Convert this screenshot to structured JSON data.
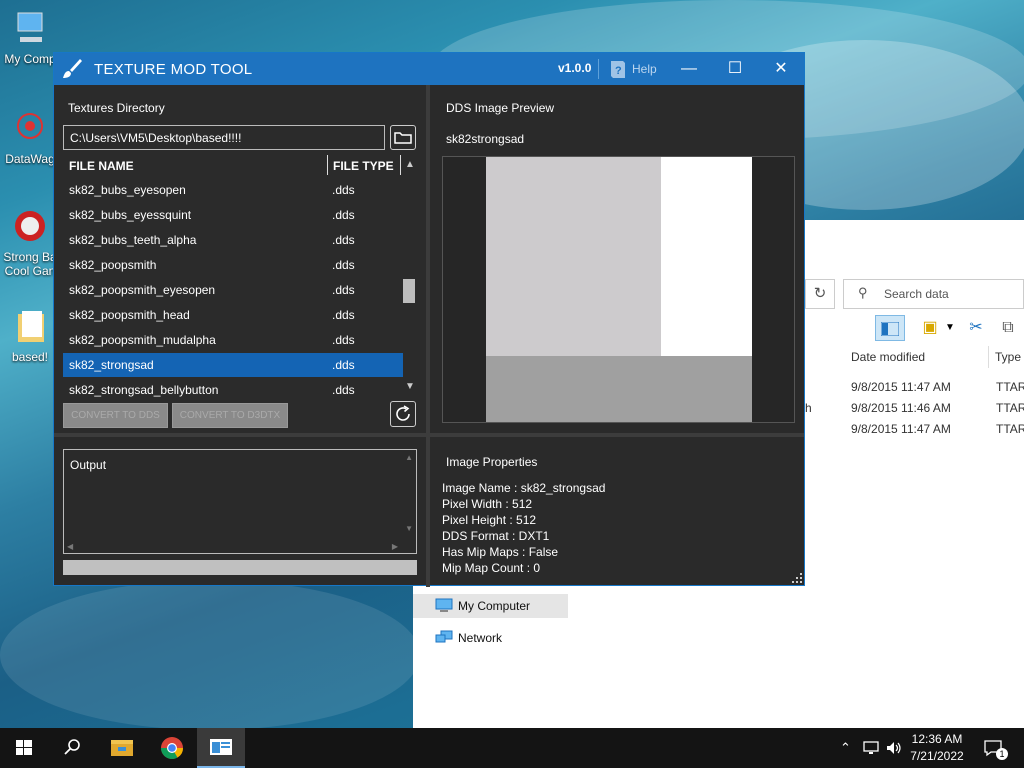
{
  "desktop": {
    "icons": [
      {
        "label": "My Comp"
      },
      {
        "label": "DataWag"
      },
      {
        "label": "Strong Ba Cool Gan"
      },
      {
        "label": "based!"
      }
    ]
  },
  "explorer": {
    "search_placeholder": "Search data",
    "columns": [
      "Date modified",
      "Type"
    ],
    "rows": [
      {
        "extra": "",
        "date": "9/8/2015 11:47 AM",
        "type": "TTARC"
      },
      {
        "extra": "h",
        "date": "9/8/2015 11:46 AM",
        "type": "TTARC"
      },
      {
        "extra": "",
        "date": "9/8/2015 11:47 AM",
        "type": "TTARC"
      }
    ],
    "nav": [
      {
        "label": "My Computer"
      },
      {
        "label": "Network"
      }
    ]
  },
  "app": {
    "title": "TEXTURE MOD TOOL",
    "version": "v1.0.0",
    "help_label": "Help",
    "textures_dir_label": "Textures Directory",
    "dir_path": "C:\\Users\\VM5\\Desktop\\based!!!!",
    "col_file_name": "FILE NAME",
    "col_file_type": "FILE TYPE",
    "files": [
      {
        "name": "sk82_bubs_eyesopen",
        "type": ".dds"
      },
      {
        "name": "sk82_bubs_eyessquint",
        "type": ".dds"
      },
      {
        "name": "sk82_bubs_teeth_alpha",
        "type": ".dds"
      },
      {
        "name": "sk82_poopsmith",
        "type": ".dds"
      },
      {
        "name": "sk82_poopsmith_eyesopen",
        "type": ".dds"
      },
      {
        "name": "sk82_poopsmith_head",
        "type": ".dds"
      },
      {
        "name": "sk82_poopsmith_mudalpha",
        "type": ".dds"
      },
      {
        "name": "sk82_strongsad",
        "type": ".dds"
      },
      {
        "name": "sk82_strongsad_bellybutton",
        "type": ".dds"
      }
    ],
    "selected_index": 7,
    "convert_dds_label": "CONVERT TO DDS",
    "convert_d3dtx_label": "CONVERT TO D3DTX",
    "output_label": "Output",
    "preview_title": "DDS Image Preview",
    "preview_name": "sk82strongsad",
    "properties_title": "Image Properties",
    "properties": [
      "Image Name : sk82_strongsad",
      "Pixel Width : 512",
      "Pixel Height : 512",
      "DDS Format : DXT1",
      "Has Mip Maps : False",
      "Mip Map Count : 0"
    ],
    "colors": {
      "titlebar": "#1e73c0",
      "selection": "#1464b4",
      "background": "#2a2a2a"
    }
  },
  "taskbar": {
    "time": "12:36 AM",
    "date": "7/21/2022",
    "notification_count": "1"
  }
}
